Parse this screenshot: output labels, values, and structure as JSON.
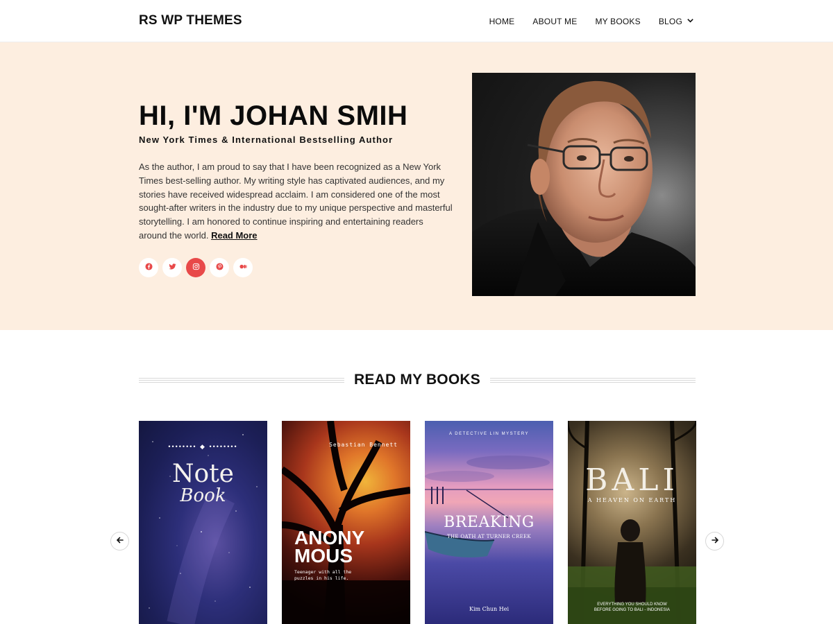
{
  "site": {
    "title": "RS WP THEMES"
  },
  "nav": [
    {
      "label": "HOME"
    },
    {
      "label": "ABOUT ME"
    },
    {
      "label": "MY BOOKS"
    },
    {
      "label": "BLOG",
      "icon": "chevron-down-icon"
    }
  ],
  "hero": {
    "title": "HI, I'M JOHAN SMIH",
    "subtitle": "New York Times & International Bestselling Author",
    "body": "As the author, I am proud to say that I have been recognized as a New York Times best-selling author. My writing style has captivated audiences, and my stories have received widespread acclaim. I am considered one of the most sought-after writers in the industry due to my unique perspective and masterful storytelling. I am honored to continue inspiring and entertaining readers around the world.",
    "read_more": "Read More",
    "socials": [
      {
        "icon": "facebook-icon"
      },
      {
        "icon": "twitter-icon"
      },
      {
        "icon": "instagram-icon",
        "active": true
      },
      {
        "icon": "pinterest-icon"
      },
      {
        "icon": "medium-icon"
      }
    ],
    "colors": {
      "background": "#fdeee0",
      "accent": "#e84949",
      "social_icon": "#e84949"
    }
  },
  "books_section": {
    "title": "READ MY BOOKS",
    "prev_icon": "arrow-left-icon",
    "next_icon": "arrow-right-icon",
    "books": [
      {
        "title_line1": "Note",
        "title_line2": "Book"
      },
      {
        "author": "Sebastian Bennett",
        "title_line1": "ANONY",
        "title_line2": "MOUS",
        "tagline": "Teenager with all the puzzles in his life."
      },
      {
        "series": "A DETECTIVE LIN MYSTERY",
        "title": "BREAKING",
        "subtitle": "THE OATH AT TURNER CREEK",
        "author": "Kim Chun Hei"
      },
      {
        "title": "BALI",
        "subtitle": "A HEAVEN ON EARTH",
        "footer": "EVERYTHING YOU SHOULD KNOW BEFORE GOING TO BALI - INDONESIA"
      }
    ]
  }
}
